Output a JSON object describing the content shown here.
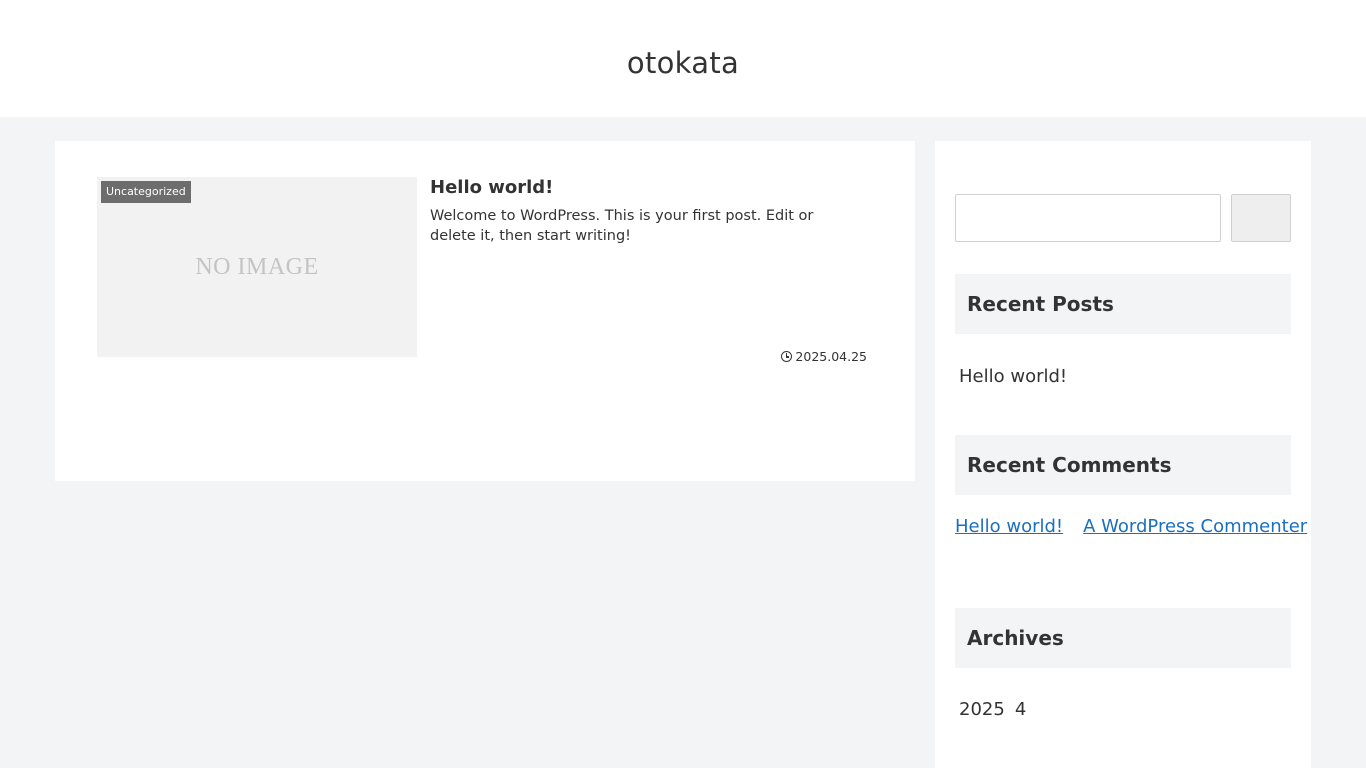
{
  "header": {
    "site_title": "otokata"
  },
  "post": {
    "category": "Uncategorized",
    "thumbnail_text": "NO IMAGE",
    "title": "Hello world!",
    "excerpt": "Welcome to WordPress. This is your first post. Edit or delete it, then start writing!",
    "date": "2025.04.25",
    "date_icon": "clock-icon"
  },
  "sidebar": {
    "search": {
      "value": "",
      "placeholder": ""
    },
    "recent_posts": {
      "heading": "Recent Posts",
      "items": [
        "Hello world!"
      ]
    },
    "recent_comments": {
      "heading": "Recent Comments",
      "items": [
        {
          "post": "Hello world!",
          "author": "A WordPress Commenter"
        }
      ]
    },
    "archives": {
      "heading": "Archives",
      "items": [
        {
          "year": "2025",
          "month": "4"
        }
      ]
    }
  },
  "colors": {
    "background": "#f3f4f6",
    "link": "#1a6fbf",
    "category_badge": "#6d6d6d"
  }
}
